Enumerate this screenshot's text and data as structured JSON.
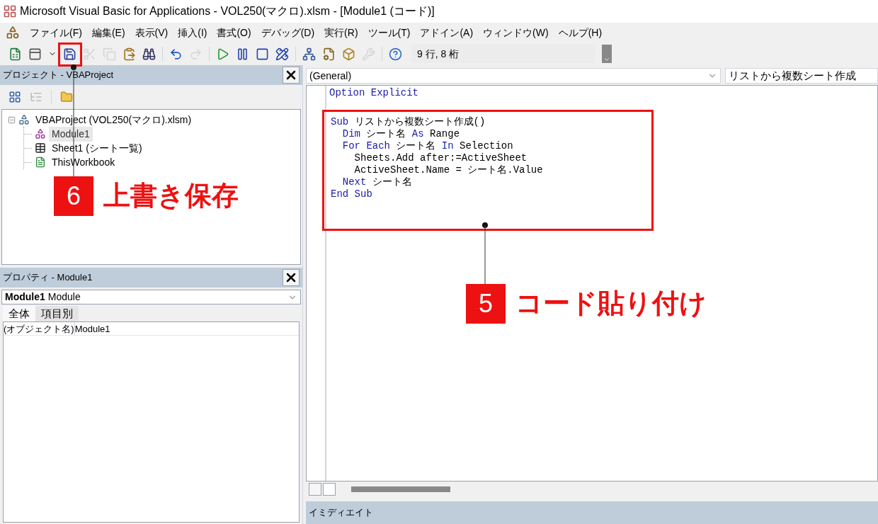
{
  "window": {
    "title": "Microsoft Visual Basic for Applications - VOL250(マクロ).xlsm - [Module1 (コード)]"
  },
  "menu": {
    "items": [
      "ファイル(F)",
      "編集(E)",
      "表示(V)",
      "挿入(I)",
      "書式(O)",
      "デバッグ(D)",
      "実行(R)",
      "ツール(T)",
      "アドイン(A)",
      "ウィンドウ(W)",
      "ヘルプ(H)"
    ]
  },
  "toolbar": {
    "buttons": [
      {
        "kind": "excel",
        "disabled": false
      },
      {
        "kind": "insert",
        "disabled": false
      },
      {
        "kind": "save",
        "disabled": false
      },
      {
        "kind": "cut",
        "disabled": true
      },
      {
        "kind": "copy",
        "disabled": true
      },
      {
        "kind": "paste",
        "disabled": false
      },
      {
        "kind": "find",
        "disabled": false
      },
      {
        "kind": "undo",
        "disabled": false
      },
      {
        "kind": "redo",
        "disabled": true
      },
      {
        "kind": "run",
        "disabled": false
      },
      {
        "kind": "pause",
        "disabled": false
      },
      {
        "kind": "stop",
        "disabled": false
      },
      {
        "kind": "design",
        "disabled": false
      },
      {
        "kind": "explorer",
        "disabled": false
      },
      {
        "kind": "properties",
        "disabled": false
      },
      {
        "kind": "browser",
        "disabled": false
      },
      {
        "kind": "toolbox",
        "disabled": true
      },
      {
        "kind": "help",
        "disabled": false
      }
    ],
    "position": "9 行, 8 桁"
  },
  "project": {
    "title": "プロジェクト - VBAProject",
    "tree": [
      {
        "label": "VBAProject (VOL250(マクロ).xlsm)",
        "kind": "project",
        "expanded": true,
        "selected": false,
        "children": [
          {
            "label": "Module1",
            "kind": "module",
            "selected": true
          },
          {
            "label": "Sheet1 (シート一覧)",
            "kind": "sheet",
            "selected": false
          },
          {
            "label": "ThisWorkbook",
            "kind": "workbook",
            "selected": false
          }
        ]
      }
    ]
  },
  "properties": {
    "title": "プロパティ - Module1",
    "object": {
      "name": "Module1",
      "type": "Module"
    },
    "tabs": [
      {
        "label": "全体",
        "selected": true
      },
      {
        "label": "項目別",
        "selected": false
      }
    ],
    "rows": [
      {
        "name": "(オブジェクト名)",
        "value": "Module1"
      }
    ]
  },
  "code": {
    "object": "(General)",
    "procedure": "リストから複数シート作成",
    "sections": [
      {
        "highlighted": false,
        "lines": [
          [
            {
              "text": "Option Explicit",
              "kind": "keyword"
            }
          ]
        ]
      },
      {
        "highlighted": true,
        "lines": [
          [
            {
              "text": "Sub",
              "kind": "keyword"
            },
            {
              "text": " リストから複数シート作成()",
              "kind": "plain"
            }
          ],
          [
            {
              "text": "  Dim",
              "kind": "keyword"
            },
            {
              "text": " シート名 ",
              "kind": "plain"
            },
            {
              "text": "As",
              "kind": "keyword"
            },
            {
              "text": " Range",
              "kind": "plain"
            }
          ],
          [
            {
              "text": "  For Each",
              "kind": "keyword"
            },
            {
              "text": " シート名 ",
              "kind": "plain"
            },
            {
              "text": "In",
              "kind": "keyword"
            },
            {
              "text": " Selection",
              "kind": "plain"
            }
          ],
          [
            {
              "text": "    Sheets.Add after:=ActiveSheet",
              "kind": "plain"
            }
          ],
          [
            {
              "text": "    ActiveSheet.Name = シート名.Value",
              "kind": "plain"
            }
          ],
          [
            {
              "text": "  Next",
              "kind": "keyword"
            },
            {
              "text": " シート名",
              "kind": "plain"
            }
          ],
          [
            {
              "text": "End Sub",
              "kind": "keyword"
            }
          ]
        ]
      }
    ]
  },
  "immediate": {
    "title": "イミディエイト"
  },
  "annotations": [
    {
      "number": "6",
      "label": "上書き保存"
    },
    {
      "number": "5",
      "label": "コード貼り付け"
    }
  ]
}
